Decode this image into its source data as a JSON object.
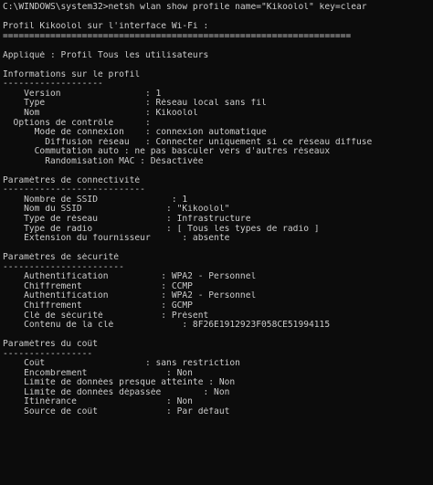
{
  "console": {
    "background": "#0c0c0c",
    "foreground": "#cccccc",
    "lines": [
      "C:\\WINDOWS\\system32>netsh wlan show profile name=\"Kikoolol\" key=clear",
      "",
      "Profil Kikoolol sur l'interface Wi-Fi :",
      "==================================================================",
      "",
      "Appliqué : Profil Tous les utilisateurs",
      "",
      "Informations sur le profil",
      "-------------------",
      "    Version                : 1",
      "    Type                   : Réseau local sans fil",
      "    Nom                    : Kikoolol",
      "  Options de contrôle      :",
      "      Mode de connexion    : connexion automatique",
      "        Diffusion réseau   : Connecter uniquement si ce réseau diffuse",
      "      Commutation auto : ne pas basculer vers d'autres réseaux",
      "        Randomisation MAC : Désactivée",
      "",
      "Paramètres de connectivité",
      "---------------------------",
      "    Nombre de SSID              : 1",
      "    Nom du SSID                : \"Kikoolol\"",
      "    Type de réseau             : Infrastructure",
      "    Type de radio              : [ Tous les types de radio ]",
      "    Extension du fournisseur      : absente",
      "",
      "Paramètres de sécurité",
      "-----------------------",
      "    Authentification          : WPA2 - Personnel",
      "    Chiffrement               : CCMP",
      "    Authentification          : WPA2 - Personnel",
      "    Chiffrement               : GCMP",
      "    Clé de sécurité           : Présent",
      "    Contenu de la clé             : 8F26E1912923F058CE51994115",
      "",
      "Paramètres du coût",
      "-----------------",
      "    Coût                   : sans restriction",
      "    Encombrement               : Non",
      "    Limite de données presque atteinte : Non",
      "    Limite de données dépassée        : Non",
      "    Itinérance                 : Non",
      "    Source de coût             : Par défaut",
      ""
    ]
  }
}
